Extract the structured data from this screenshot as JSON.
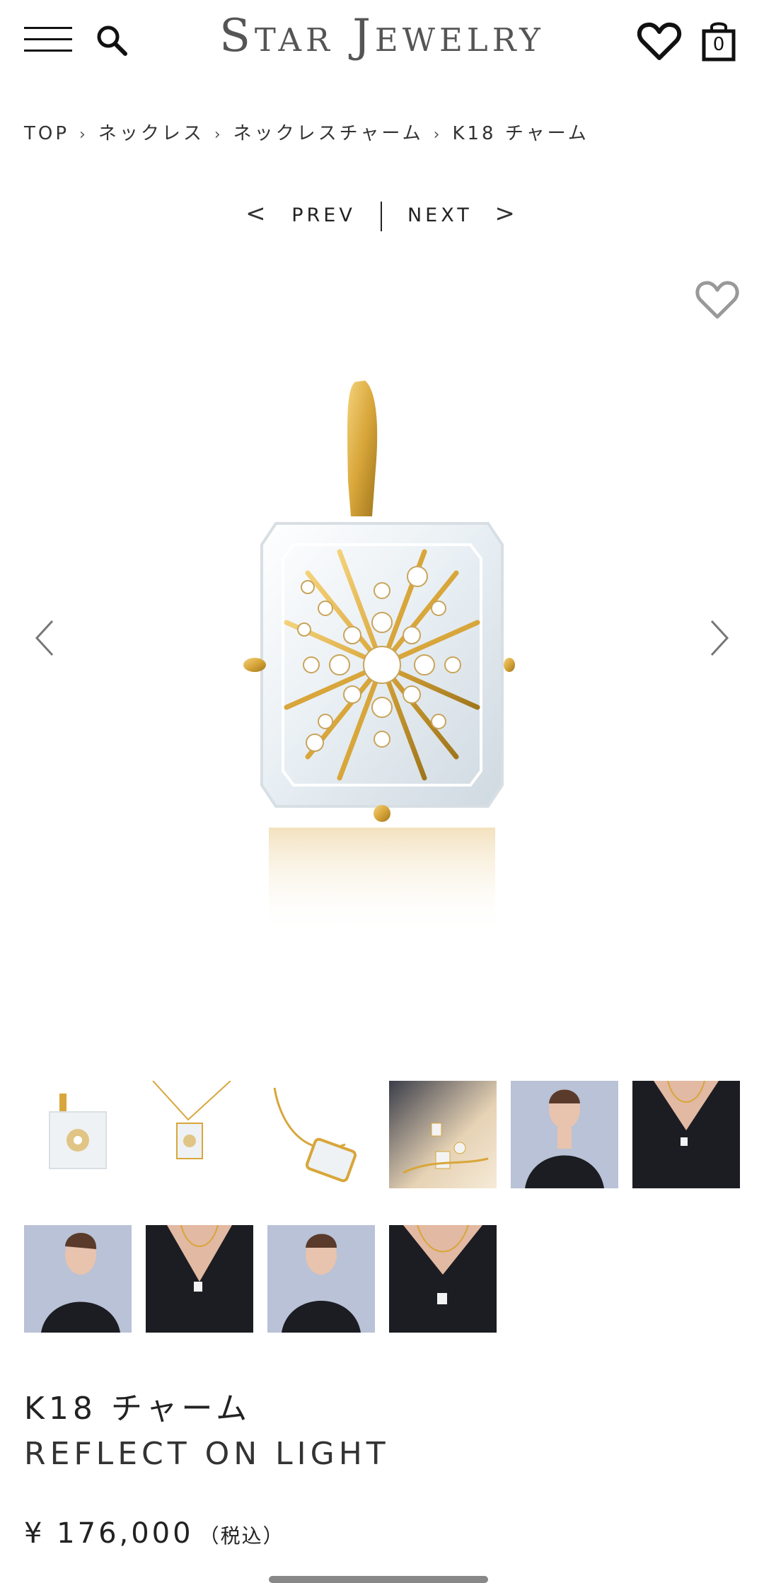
{
  "header": {
    "logo": "Star Jewelry",
    "cart_count": "0"
  },
  "breadcrumb": {
    "items": [
      "TOP",
      "ネックレス",
      "ネックレスチャーム",
      "K18 チャーム"
    ]
  },
  "pager": {
    "prev_label": "PREV",
    "next_label": "NEXT",
    "prev_arrow": "<",
    "next_arrow": ">"
  },
  "product": {
    "name": "K18 チャーム",
    "collection": "REFLECT ON LIGHT",
    "price": "¥ 176,000",
    "tax_note": "（税込）"
  },
  "gallery": {
    "thumbnail_count": 10
  },
  "colors": {
    "gold": "#d8a63a",
    "dark_dress": "#1c1d22",
    "text": "#222222"
  }
}
